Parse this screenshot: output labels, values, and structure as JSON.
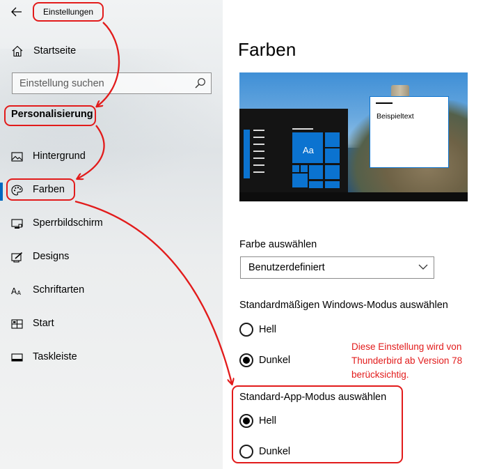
{
  "window": {
    "title": "Einstellungen"
  },
  "sidebar": {
    "home_label": "Startseite",
    "search": {
      "placeholder": "Einstellung suchen",
      "value": ""
    },
    "section_heading": "Personalisierung",
    "items": [
      {
        "label": "Hintergrund",
        "icon": "picture-icon",
        "selected": false
      },
      {
        "label": "Farben",
        "icon": "palette-icon",
        "selected": true
      },
      {
        "label": "Sperrbildschirm",
        "icon": "lock-screen-icon",
        "selected": false
      },
      {
        "label": "Designs",
        "icon": "designs-icon",
        "selected": false
      },
      {
        "label": "Schriftarten",
        "icon": "fonts-icon",
        "selected": false
      },
      {
        "label": "Start",
        "icon": "start-icon",
        "selected": false
      },
      {
        "label": "Taskleiste",
        "icon": "taskbar-icon",
        "selected": false
      }
    ]
  },
  "main": {
    "title": "Farben",
    "preview": {
      "tile_label": "Aa",
      "window_text": "Beispieltext"
    },
    "color_select": {
      "label": "Farbe auswählen",
      "value": "Benutzerdefiniert"
    },
    "windows_mode": {
      "label": "Standardmäßigen Windows-Modus auswählen",
      "options": [
        {
          "label": "Hell",
          "checked": false
        },
        {
          "label": "Dunkel",
          "checked": true
        }
      ]
    },
    "app_mode": {
      "label": "Standard-App-Modus auswählen",
      "options": [
        {
          "label": "Hell",
          "checked": true
        },
        {
          "label": "Dunkel",
          "checked": false
        }
      ]
    }
  },
  "annotation": {
    "note_lines": [
      "Diese Einstellung wird von",
      "Thunderbird ab Version 78",
      "berücksichtig."
    ]
  },
  "colors": {
    "accent": "#0067c0",
    "preview_accent": "#0b73d0",
    "annotation_red": "#e21b1b"
  }
}
